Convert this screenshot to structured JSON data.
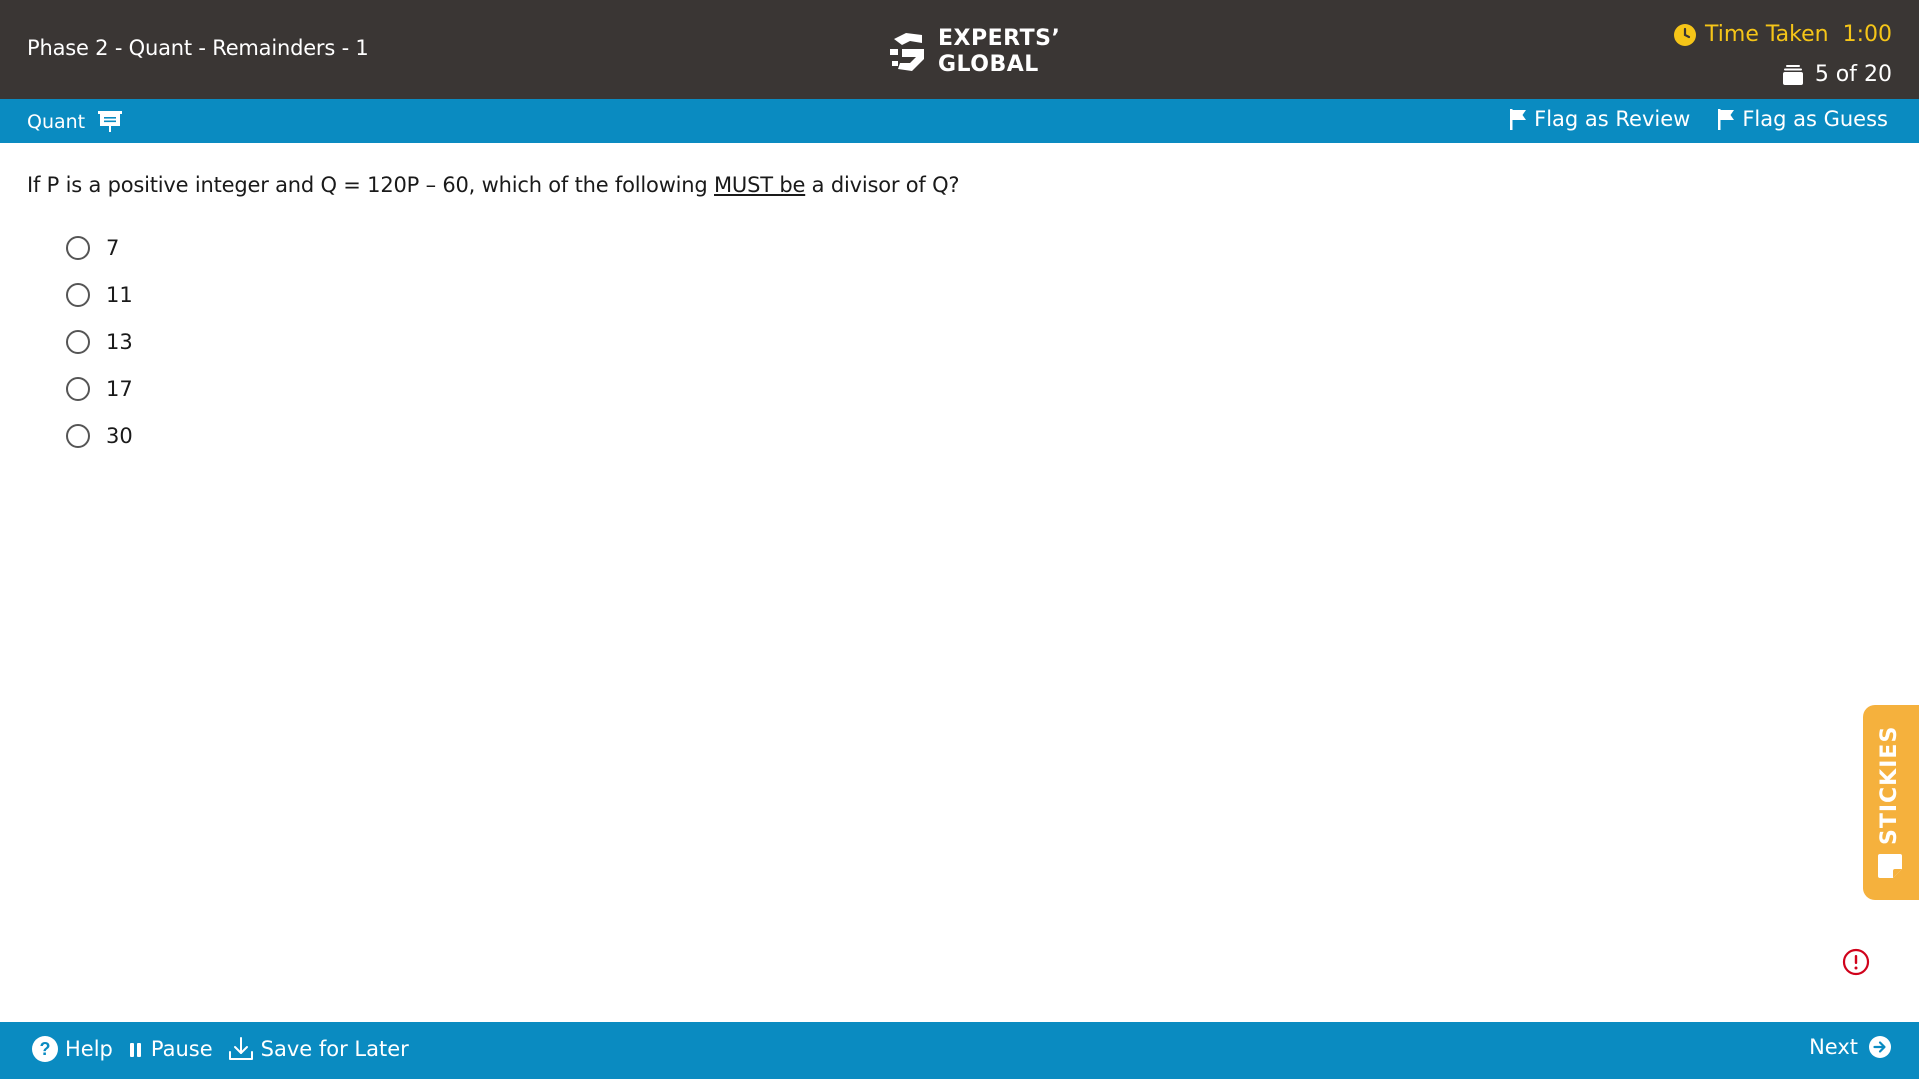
{
  "header": {
    "test_title": "Phase 2 - Quant - Remainders - 1",
    "logo_line1": "EXPERTS’",
    "logo_line2": "GLOBAL",
    "timer_label": "Time Taken",
    "timer_value": "1:00",
    "question_progress": "5 of 20",
    "timer_color": "#f5c518",
    "bg_color": "#3a3634"
  },
  "section_bar": {
    "section_name": "Quant",
    "section_icon": "presentation-board-icon",
    "flag_review_label": "Flag as Review",
    "flag_guess_label": "Flag as Guess",
    "bg_color": "#0a8bc1"
  },
  "question": {
    "text_before": "If P is a positive integer and Q = 120P – 60, which of the following ",
    "text_underlined": "MUST be",
    "text_after": " a divisor of Q?",
    "options": [
      "7",
      "11",
      "13",
      "17",
      "30"
    ]
  },
  "stickies": {
    "label": "STICKIES",
    "icon": "sticky-note-icon",
    "color": "#f5b13d"
  },
  "alert": {
    "icon": "alert-circle-icon",
    "color": "#d0021b"
  },
  "footer": {
    "help_label": "Help",
    "pause_label": "Pause",
    "save_label": "Save for Later",
    "next_label": "Next"
  }
}
